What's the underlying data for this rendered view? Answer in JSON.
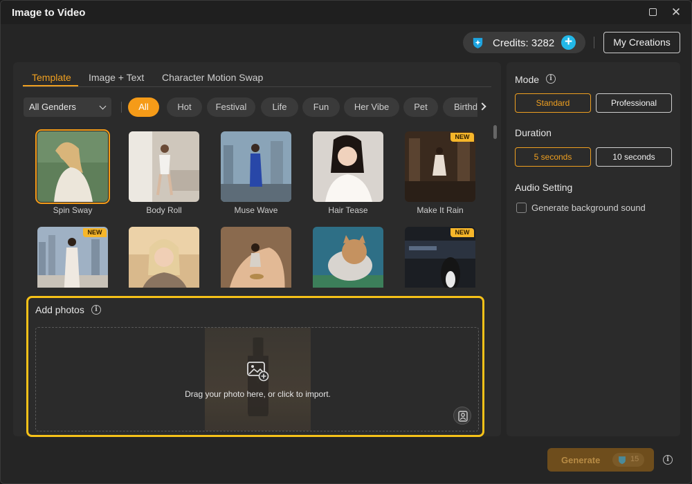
{
  "window": {
    "title": "Image to Video",
    "controls": [
      "maximize-icon",
      "close-icon"
    ]
  },
  "header": {
    "credits_label": "Credits: 3282",
    "add_credits": "+",
    "my_creations": "My Creations"
  },
  "tabs": [
    "Template",
    "Image + Text",
    "Character Motion Swap"
  ],
  "active_tab": "Template",
  "filters": {
    "gender": "All Genders",
    "chips": [
      "All",
      "Hot",
      "Festival",
      "Life",
      "Fun",
      "Her Vibe",
      "Pet",
      "Birthday"
    ],
    "active_chip": "All"
  },
  "templates": [
    {
      "label": "Spin Sway",
      "badge": "",
      "selected": true
    },
    {
      "label": "Body Roll",
      "badge": ""
    },
    {
      "label": "Muse Wave",
      "badge": ""
    },
    {
      "label": "Hair Tease",
      "badge": ""
    },
    {
      "label": "Make It Rain",
      "badge": "NEW"
    },
    {
      "label": "",
      "badge": "NEW"
    },
    {
      "label": "",
      "badge": ""
    },
    {
      "label": "",
      "badge": ""
    },
    {
      "label": "",
      "badge": ""
    },
    {
      "label": "",
      "badge": "NEW"
    }
  ],
  "add_photos": {
    "title": "Add photos",
    "drop_text": "Drag your photo here, or click to import."
  },
  "settings": {
    "mode_label": "Mode",
    "mode_options": [
      "Standard",
      "Professional"
    ],
    "mode_selected": "Standard",
    "duration_label": "Duration",
    "duration_options": [
      "5 seconds",
      "10 seconds"
    ],
    "duration_selected": "5 seconds",
    "audio_label": "Audio Setting",
    "audio_checkbox": "Generate background sound",
    "audio_checked": false
  },
  "footer": {
    "generate": "Generate",
    "cost": "15"
  },
  "colors": {
    "accent": "#f59b18",
    "highlight_border": "#f7c218",
    "credits_add": "#22b8e8"
  }
}
